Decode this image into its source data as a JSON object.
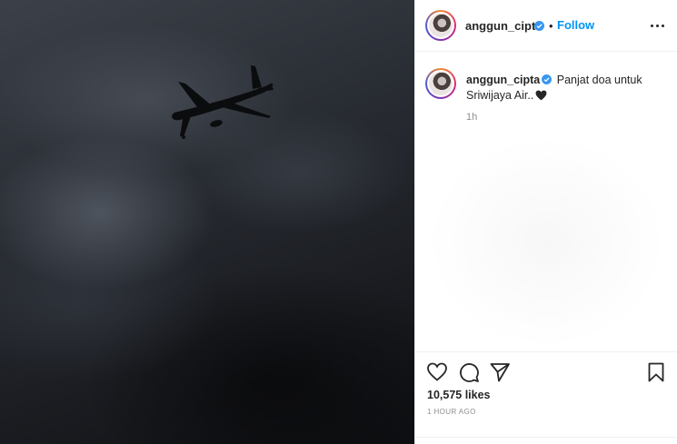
{
  "post": {
    "username": "anggun_cipta",
    "separator": "•",
    "follow_label": "Follow",
    "caption_username": "anggun_cipta",
    "caption_text": "Panjat doa untuk Sriwijaya Air..",
    "caption_time": "1h",
    "likes": "10,575 likes",
    "time_ago": "1 HOUR AGO"
  },
  "icons": {
    "verified": "verified-badge-icon",
    "heart_emoji": "black-heart-icon",
    "like": "heart-outline-icon",
    "comment": "comment-bubble-icon",
    "share": "paper-plane-icon",
    "save": "bookmark-icon",
    "more": "ellipsis-icon"
  },
  "colors": {
    "link": "#0095f6",
    "verified": "#3897f0",
    "text": "#262626",
    "muted": "#8e8e8e"
  }
}
